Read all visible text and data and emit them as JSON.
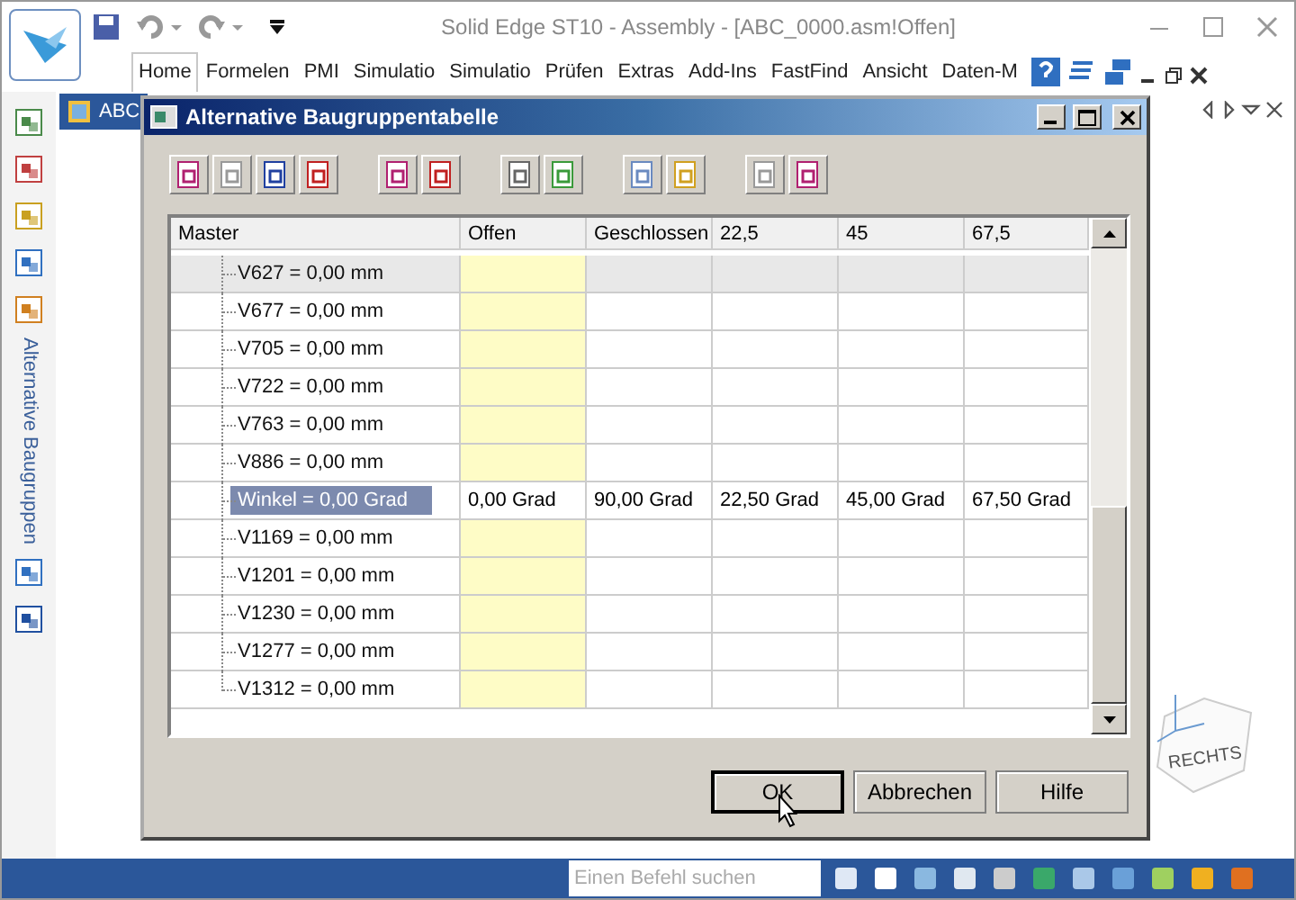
{
  "window": {
    "title": "Solid Edge ST10 - Assembly - [ABC_0000.asm!Offen]"
  },
  "ribbon_tabs": [
    {
      "label": "Home",
      "selected": true
    },
    {
      "label": "Formelen",
      "selected": false
    },
    {
      "label": "PMI",
      "selected": false
    },
    {
      "label": "Simulatio",
      "selected": false
    },
    {
      "label": "Simulatio",
      "selected": false
    },
    {
      "label": "Prüfen",
      "selected": false
    },
    {
      "label": "Extras",
      "selected": false
    },
    {
      "label": "Add-Ins",
      "selected": false
    },
    {
      "label": "FastFind",
      "selected": false
    },
    {
      "label": "Ansicht",
      "selected": false
    },
    {
      "label": "Daten-M",
      "selected": false
    }
  ],
  "document_tab": {
    "label": "ABC"
  },
  "side_panel": {
    "label": "Alternative Baugruppen"
  },
  "dialog": {
    "title": "Alternative Baugruppentabelle",
    "columns": [
      "Master",
      "Offen",
      "Geschlossen",
      "22,5",
      "45",
      "67,5"
    ],
    "rows": [
      {
        "master": "V627 = 0,00 mm",
        "selected": false,
        "shaded": true,
        "highlighted": true
      },
      {
        "master": "V677 = 0,00 mm",
        "selected": false,
        "shaded": false,
        "highlighted": true
      },
      {
        "master": "V705 = 0,00 mm",
        "selected": false,
        "shaded": false,
        "highlighted": true
      },
      {
        "master": "V722 = 0,00 mm",
        "selected": false,
        "shaded": false,
        "highlighted": true
      },
      {
        "master": "V763 = 0,00 mm",
        "selected": false,
        "shaded": false,
        "highlighted": true
      },
      {
        "master": "V886 = 0,00 mm",
        "selected": false,
        "shaded": false,
        "highlighted": true
      },
      {
        "master": "Winkel = 0,00 Grad",
        "selected": true,
        "shaded": false,
        "highlighted": false,
        "values": [
          "0,00 Grad",
          "90,00 Grad",
          "22,50 Grad",
          "45,00 Grad",
          "67,50 Grad"
        ]
      },
      {
        "master": "V1169 = 0,00 mm",
        "selected": false,
        "shaded": false,
        "highlighted": true
      },
      {
        "master": "V1201 = 0,00 mm",
        "selected": false,
        "shaded": false,
        "highlighted": true
      },
      {
        "master": "V1230 = 0,00 mm",
        "selected": false,
        "shaded": false,
        "highlighted": true
      },
      {
        "master": "V1277 = 0,00 mm",
        "selected": false,
        "shaded": false,
        "highlighted": true
      },
      {
        "master": "V1312 = 0,00 mm",
        "selected": false,
        "shaded": false,
        "highlighted": true
      }
    ],
    "buttons": [
      {
        "label": "OK",
        "default": true
      },
      {
        "label": "Abbrechen",
        "default": false
      },
      {
        "label": "Hilfe",
        "default": false
      }
    ]
  },
  "view_cube": {
    "label": "RECHTS"
  },
  "status_bar": {
    "search_placeholder": "Einen Befehl suchen"
  }
}
